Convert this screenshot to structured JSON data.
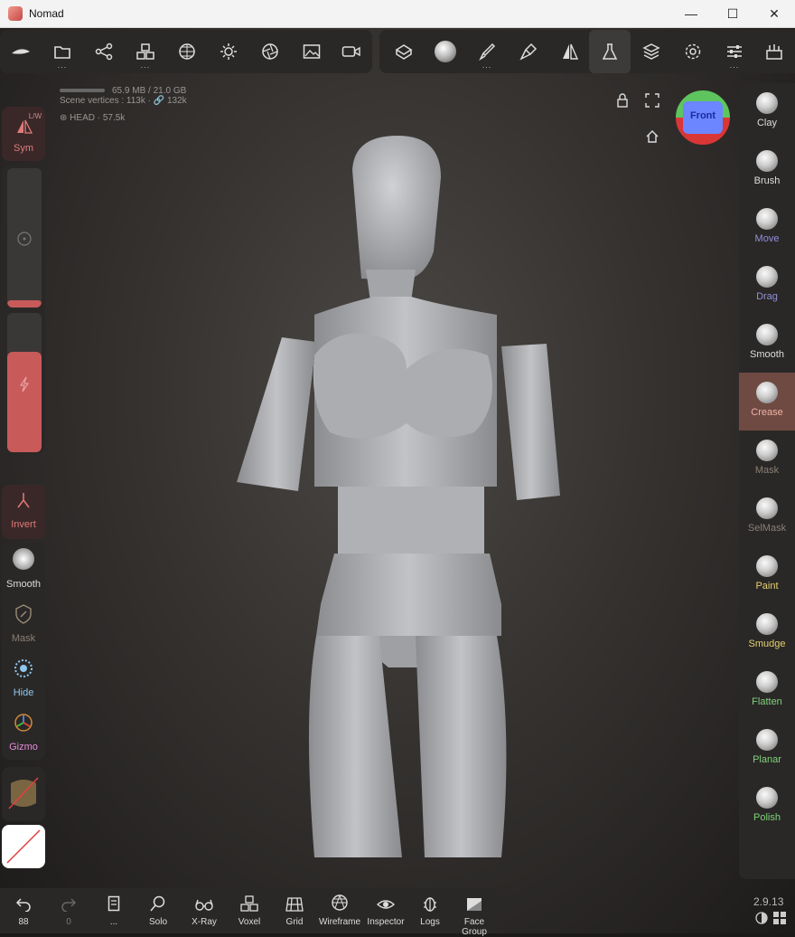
{
  "window": {
    "title": "Nomad"
  },
  "topbar": {
    "left_icons": [
      "logo-icon",
      "folder-icon",
      "scene-icon",
      "primitives-icon",
      "topology-icon",
      "light-icon",
      "aperture-icon",
      "image-icon",
      "camera-icon"
    ],
    "right_icons": [
      "sculpt-icon",
      "material-icon",
      "paint-icon",
      "brush-icon",
      "symmetry-icon",
      "flask-icon",
      "layers-icon",
      "settings-icon",
      "sliders-icon",
      "tools-icon"
    ],
    "dots": "..."
  },
  "stats": {
    "memory": "65.9 MB / 21.0 GB",
    "vertices": "Scene vertices : 113k · 🔗 132k",
    "object": "HEAD · 57.5k"
  },
  "left_panel": {
    "sym_label": "Sym",
    "sym_sub": "L/W",
    "invert_label": "Invert",
    "smooth_label": "Smooth",
    "mask_label": "Mask",
    "hide_label": "Hide",
    "gizmo_label": "Gizmo",
    "radius_value": 0.05,
    "intensity_value": 0.72
  },
  "gizmo": {
    "label": "Front"
  },
  "right_tools": [
    {
      "label": "Clay",
      "color": "#dddddd"
    },
    {
      "label": "Brush",
      "color": "#dddddd"
    },
    {
      "label": "Move",
      "color": "#8f8fd9"
    },
    {
      "label": "Drag",
      "color": "#8f8fd9"
    },
    {
      "label": "Smooth",
      "color": "#dddddd"
    },
    {
      "label": "Crease",
      "color": "#f0b2a5"
    },
    {
      "label": "Mask",
      "color": "#8a7e73"
    },
    {
      "label": "SelMask",
      "color": "#8a7e73"
    },
    {
      "label": "Paint",
      "color": "#e6d06e"
    },
    {
      "label": "Smudge",
      "color": "#e6d06e"
    },
    {
      "label": "Flatten",
      "color": "#7fd17a"
    },
    {
      "label": "Planar",
      "color": "#7fd17a"
    },
    {
      "label": "Polish",
      "color": "#7fd17a"
    }
  ],
  "bottombar": {
    "undo_count": "88",
    "redo_count": "0",
    "items": [
      "...",
      "Solo",
      "X-Ray",
      "Voxel",
      "Grid",
      "Wireframe",
      "Inspector",
      "Logs",
      "Face Group"
    ]
  },
  "version": "2.9.13"
}
